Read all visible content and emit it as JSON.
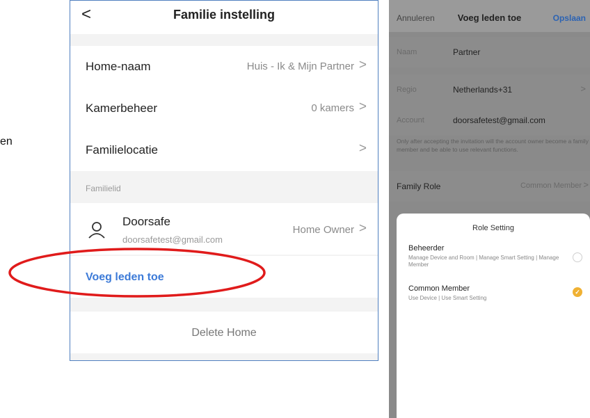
{
  "fragment": {
    "text": "en"
  },
  "left": {
    "header": {
      "back_glyph": "<",
      "title": "Familie instelling"
    },
    "rows": [
      {
        "label": "Home-naam",
        "value": "Huis - Ik & Mijn Partner",
        "chevron": ">"
      },
      {
        "label": "Kamerbeheer",
        "value": "0 kamers",
        "chevron": ">"
      },
      {
        "label": "Familielocatie",
        "value": "",
        "chevron": ">"
      }
    ],
    "section_label": "Familielid",
    "member": {
      "name": "Doorsafe",
      "email": "doorsafetest@gmail.com",
      "role": "Home Owner",
      "chevron": ">",
      "avatar_icon": "person-icon"
    },
    "add_member": "Voeg leden toe",
    "delete_home": "Delete Home",
    "highlight_color": "#e01b1b"
  },
  "right": {
    "header": {
      "cancel": "Annuleren",
      "title": "Voeg leden toe",
      "save": "Opslaan"
    },
    "fields": [
      {
        "key": "Naam",
        "value": "Partner",
        "chevron": ""
      },
      {
        "key": "Regio",
        "value": "Netherlands+31",
        "chevron": ">"
      },
      {
        "key": "Account",
        "value": "doorsafetest@gmail.com",
        "chevron": ""
      }
    ],
    "note": "Only after accepting the invitation will the account owner become a family member and be able to use relevant functions.",
    "family_role": {
      "key": "Family Role",
      "value": "Common Member",
      "chevron": ">"
    },
    "role_sheet": {
      "title": "Role Setting",
      "options": [
        {
          "title": "Beheerder",
          "desc": "Manage Device and Room | Manage Smart Setting | Manage Member",
          "selected": false
        },
        {
          "title": "Common Member",
          "desc": "Use Device | Use Smart Setting",
          "selected": true,
          "check_glyph": "✓"
        }
      ]
    },
    "accent_color": "#f0b133"
  }
}
